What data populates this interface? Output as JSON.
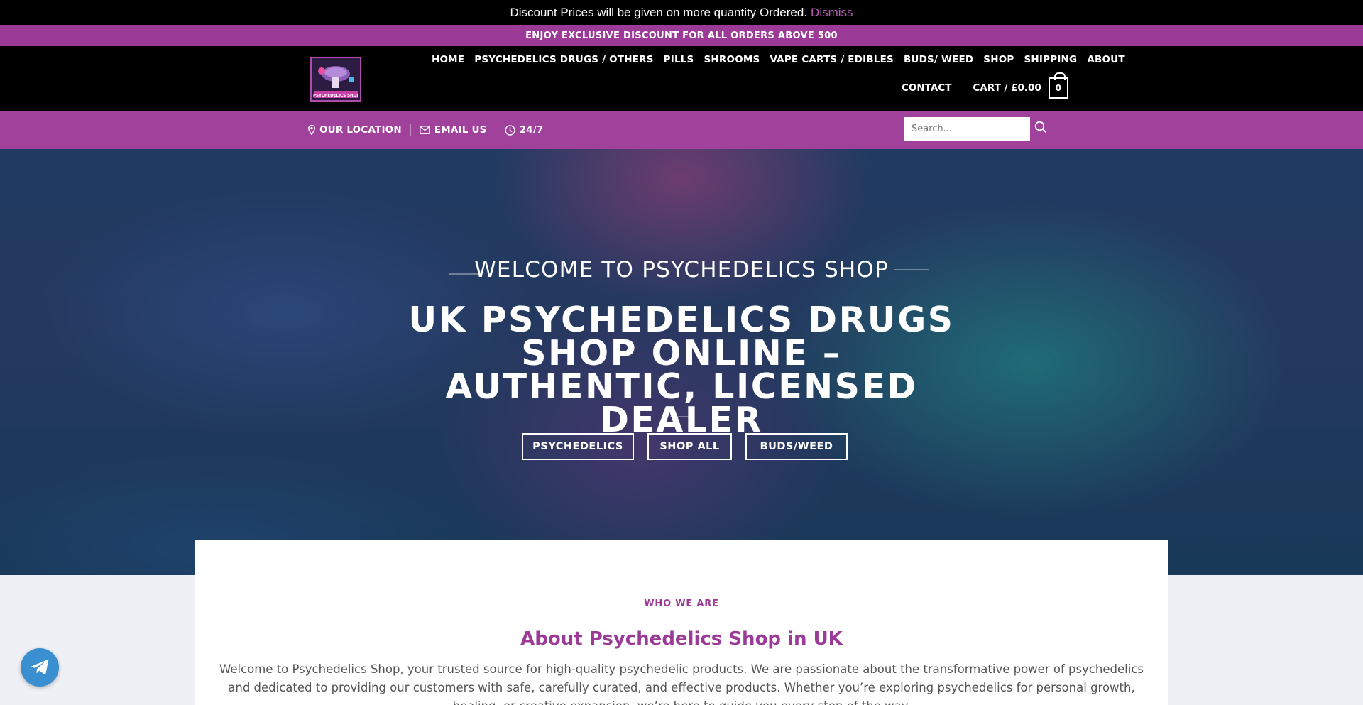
{
  "notice": {
    "text": "Discount Prices will be given on more quantity Ordered.",
    "dismiss": "Dismiss"
  },
  "promo": {
    "text": "ENJOY EXCLUSIVE DISCOUNT FOR ALL ORDERS ABOVE 500"
  },
  "header": {
    "logo_text": "PSYCHEDELICS SHOP",
    "nav": [
      {
        "label": "HOME"
      },
      {
        "label": "PSYCHEDELICS DRUGS / OTHERS"
      },
      {
        "label": "PILLS"
      },
      {
        "label": "SHROOMS"
      },
      {
        "label": "VAPE CARTS / EDIBLES"
      },
      {
        "label": "BUDS/ WEED"
      },
      {
        "label": "SHOP"
      },
      {
        "label": "SHIPPING"
      },
      {
        "label": "ABOUT"
      }
    ],
    "contact": "CONTACT",
    "cart_label": "CART / £0.00",
    "cart_count": "0"
  },
  "subbar": {
    "location": "OUR LOCATION",
    "email": "EMAIL US",
    "hours": "24/7",
    "search_placeholder": "Search..."
  },
  "hero": {
    "subtitle": "WELCOME TO PSYCHEDELICS SHOP",
    "title": "UK PSYCHEDELICS DRUGS SHOP ONLINE – AUTHENTIC, LICENSED DEALER",
    "buttons": [
      {
        "label": "PSYCHEDELICS"
      },
      {
        "label": "SHOP ALL"
      },
      {
        "label": "BUDS/WEED"
      }
    ]
  },
  "about": {
    "eyebrow": "WHO WE ARE",
    "title": "About Psychedelics Shop in UK",
    "body": "Welcome to Psychedelics Shop, your trusted source for high-quality psychedelic products. We are passionate about the transformative power of psychedelics and dedicated to providing our customers with safe, carefully curated, and effective products. Whether you’re exploring psychedelics for personal growth, healing, or creative expansion, we’re here to guide you every step of the way."
  },
  "colors": {
    "accent": "#9b3b97",
    "header_bg": "#000000",
    "telegram": "#3a8fd1"
  },
  "icons": {
    "location": "map-pin-icon",
    "email": "envelope-icon",
    "hours": "clock-icon",
    "search": "search-icon",
    "cart": "bag-icon",
    "telegram": "telegram-icon"
  }
}
